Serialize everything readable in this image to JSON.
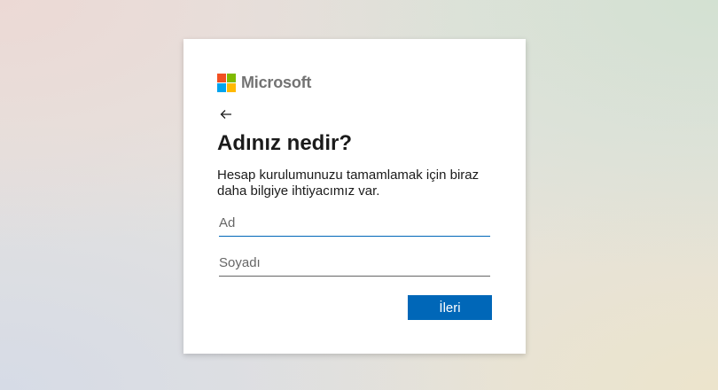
{
  "brand": {
    "name": "Microsoft",
    "colors": {
      "red": "#f25022",
      "green": "#7fba00",
      "blue": "#00a4ef",
      "yellow": "#ffb900"
    }
  },
  "identity": {
    "back_icon": "arrow-left-icon",
    "text": ""
  },
  "form": {
    "title": "Adınız nedir?",
    "description": "Hesap kurulumunuzu tamamlamak için biraz daha bilgiye ihtiyacımız var.",
    "first_name": {
      "placeholder": "Ad",
      "value": ""
    },
    "last_name": {
      "placeholder": "Soyadı",
      "value": ""
    },
    "next_label": "İleri"
  },
  "accent_color": "#0067b8"
}
